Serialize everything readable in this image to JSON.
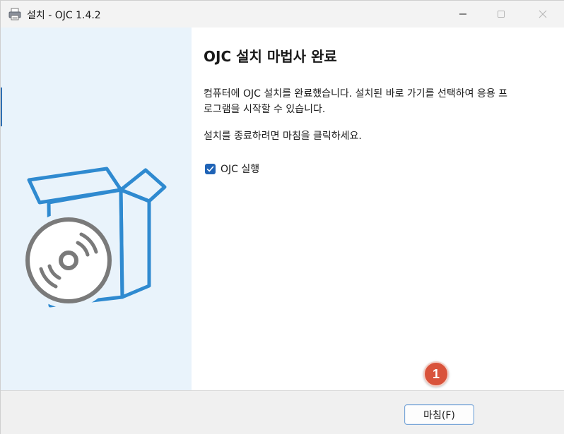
{
  "titlebar": {
    "title": "설치 - OJC 1.4.2",
    "icon": "installer-printer-icon",
    "minimize_icon": "minimize-icon",
    "maximize_icon": "maximize-icon",
    "close_icon": "close-icon"
  },
  "sidebar": {
    "illustration": "software-box-disc-illustration",
    "accent_color": "#2f8ad0",
    "disc_color": "#7a7a7a"
  },
  "main": {
    "heading": "OJC 설치 마법사 완료",
    "description_line1": "컴퓨터에 OJC 설치를 완료했습니다. 설치된 바로 가기를 선택하여 응용 프",
    "description_line2": "로그램을 시작할 수 있습니다.",
    "instruction": "설치를 종료하려면 마침을 클릭하세요.",
    "launch_checkbox": {
      "label": "OJC 실행",
      "checked": true
    }
  },
  "footer": {
    "finish_label": "마침(F)"
  },
  "annotation": {
    "step_number": "1",
    "color": "#d9533b"
  }
}
